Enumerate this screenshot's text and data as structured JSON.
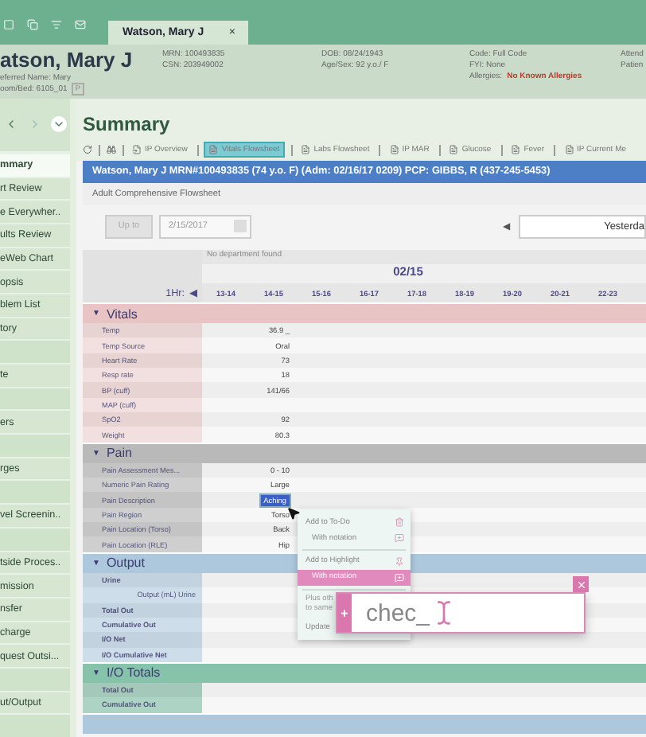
{
  "tabs": [
    {
      "label": "Watson, Mary J",
      "close": "×",
      "selected": true
    }
  ],
  "patient": {
    "name": "atson, Mary J",
    "preferred": "eferred Name: Mary",
    "room": "oom/Bed: 6105_01",
    "room_badge": "P",
    "mrn": "MRN: 100493835",
    "csn": "CSN: 203949002",
    "dob": "DOB: 08/24/1943",
    "age": "Age/Sex: 92 y.o./ F",
    "code": "Code: Full Code",
    "fyi": "FYI: None",
    "allergies_label": "Allergies:",
    "allergies": "No Known Allergies",
    "column_5": [
      "Attend",
      "Patien"
    ]
  },
  "sidebar": {
    "items": [
      {
        "kind": "item",
        "label": "mmary",
        "selected": true
      },
      {
        "kind": "item",
        "label": "rt Review",
        "selected": false
      },
      {
        "kind": "item",
        "label": "e Everywher..",
        "selected": false
      },
      {
        "kind": "item",
        "label": "ults Review",
        "selected": false
      },
      {
        "kind": "item",
        "label": "eWeb Chart",
        "selected": false
      },
      {
        "kind": "item",
        "label": "opsis",
        "selected": false
      },
      {
        "kind": "item",
        "label": "blem List",
        "selected": false
      },
      {
        "kind": "item",
        "label": "tory",
        "selected": false
      },
      {
        "kind": "spacer"
      },
      {
        "kind": "item",
        "label": "te",
        "selected": false
      },
      {
        "kind": "spacer"
      },
      {
        "kind": "item",
        "label": "ers",
        "selected": false
      },
      {
        "kind": "spacer"
      },
      {
        "kind": "item",
        "label": "rges",
        "selected": false
      },
      {
        "kind": "spacer"
      },
      {
        "kind": "item",
        "label": "vel Screenin..",
        "selected": false
      },
      {
        "kind": "spacer"
      },
      {
        "kind": "item",
        "label": "tside Proces..",
        "selected": false
      },
      {
        "kind": "item",
        "label": "mission",
        "selected": false
      },
      {
        "kind": "item",
        "label": "nsfer",
        "selected": false
      },
      {
        "kind": "item",
        "label": "charge",
        "selected": false
      },
      {
        "kind": "item",
        "label": "quest Outsi...",
        "selected": false
      },
      {
        "kind": "spacer"
      },
      {
        "kind": "item",
        "label": "ut/Output",
        "selected": false
      },
      {
        "kind": "spacer"
      }
    ]
  },
  "page_title": "Summary",
  "toolbar": [
    {
      "label": "IP Overview",
      "selected": false
    },
    {
      "label": "Vitals Flowsheet",
      "selected": true
    },
    {
      "label": "Labs Flowsheet",
      "selected": false
    },
    {
      "label": "IP MAR",
      "selected": false
    },
    {
      "label": "Glucose",
      "selected": false
    },
    {
      "label": "Fever",
      "selected": false
    },
    {
      "label": "IP Current Me",
      "selected": false
    }
  ],
  "banner": "Watson, Mary J MRN#100493835  (74 y.o. F)  (Adm: 02/16/17  0209)  PCP:  GIBBS, R  (437-245-5453)",
  "flowsheet_title": "Adult Comprehensive Flowsheet",
  "up_to": {
    "button": "Up to",
    "date": "2/15/2017",
    "disabled": true
  },
  "range": {
    "arrow": "◀",
    "value": "Yesterda"
  },
  "table": {
    "department": "No department found",
    "date": "02/15",
    "interval": "1Hr:",
    "interval_arrow": "◀",
    "columns": [
      "13-14",
      "14-15",
      "15-16",
      "16-17",
      "17-18",
      "18-19",
      "19-20",
      "20-21",
      "22-23"
    ],
    "sections": [
      {
        "arrow": "▼",
        "title": "Vitals",
        "color": "#e8c4c4",
        "rows": [
          {
            "label": "Temp",
            "value": "36.9 _"
          },
          {
            "label": "Temp Source",
            "value": "Oral"
          },
          {
            "label": "Heart Rate",
            "value": "73"
          },
          {
            "label": "Resp  rate",
            "value": "18"
          },
          {
            "label": "BP (cuff)",
            "value": "141/66"
          },
          {
            "label": "MAP (cuff)"
          },
          {
            "label": "SpO2",
            "value": "92"
          },
          {
            "label": "Weight",
            "value": "80.3"
          }
        ]
      },
      {
        "arrow": "▼",
        "title": "Pain",
        "color": "#b9b9b9",
        "rows": [
          {
            "label": "Pain Assessment Mes...",
            "value": "0 - 10",
            "selected": false
          },
          {
            "label": "Numeric Pain Rating",
            "value": "Large",
            "selected": false
          },
          {
            "label": "Pain Description",
            "value": "Aching",
            "selected": true
          },
          {
            "label": "Pain Region",
            "value": "Torso",
            "selected": false
          },
          {
            "label": "Pain Location (Torso)",
            "value": "Back",
            "selected": false
          },
          {
            "label": "Pain Location (RLE)",
            "value": "Hip",
            "selected": false
          }
        ]
      },
      {
        "arrow": "▼",
        "title": "Output",
        "color": "#adc8dc",
        "rows": [
          {
            "label": "Urine",
            "kind": "total"
          },
          {
            "label": "Output (mL) Urine",
            "kind": "sub"
          },
          {
            "label": "Total Out",
            "kind": "total"
          },
          {
            "label": "Cumulative Out",
            "kind": "total"
          },
          {
            "label": "I/O Net",
            "kind": "total"
          },
          {
            "label": "I/O Cumulative Net",
            "kind": "total"
          }
        ]
      },
      {
        "arrow": "▼",
        "title": "I/O Totals",
        "color": "#86c3aa",
        "rows": [
          {
            "label": "Total Out",
            "kind": "total"
          },
          {
            "label": "Cumulative Out",
            "kind": "total"
          }
        ]
      },
      {
        "color": "#adc8dc"
      }
    ]
  },
  "context_menu": {
    "items": [
      {
        "kind": "item",
        "label": "Add to To-Do",
        "selected": false
      },
      {
        "kind": "sub",
        "label": "With notation",
        "selected": false
      },
      {
        "kind": "divider"
      },
      {
        "kind": "item",
        "label": "Add to Highlight",
        "selected": false
      },
      {
        "kind": "sub",
        "label": "With notation",
        "selected": true
      },
      {
        "kind": "divider"
      },
      {
        "kind": "note",
        "label": "Plus oth to same"
      },
      {
        "kind": "partial",
        "label": "Update"
      }
    ]
  },
  "notation_box": {
    "value": "chec_",
    "add": "+"
  }
}
